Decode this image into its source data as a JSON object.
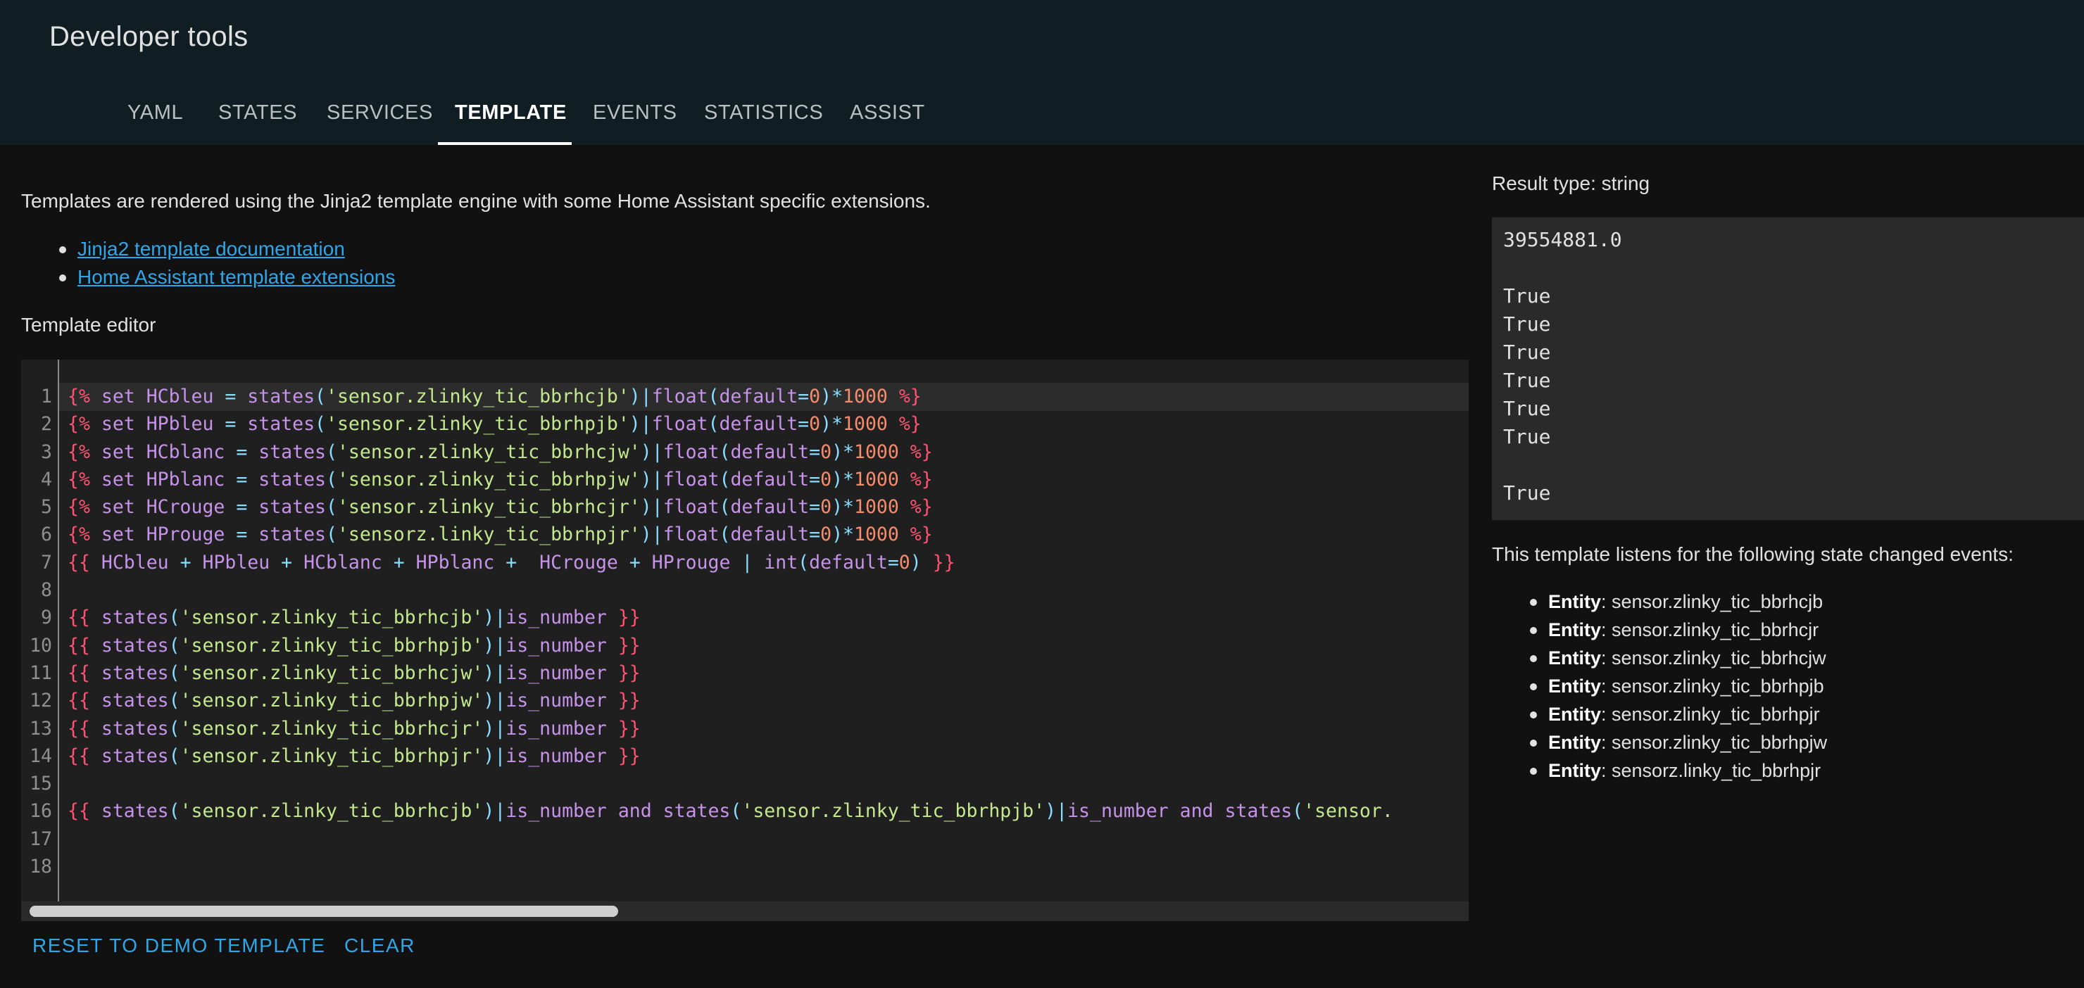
{
  "header": {
    "title": "Developer tools",
    "tabs": [
      "YAML",
      "STATES",
      "SERVICES",
      "TEMPLATE",
      "EVENTS",
      "STATISTICS",
      "ASSIST"
    ],
    "active_tab": "TEMPLATE"
  },
  "intro": "Templates are rendered using the Jinja2 template engine with some Home Assistant specific extensions.",
  "links": [
    "Jinja2 template documentation",
    "Home Assistant template extensions"
  ],
  "editor": {
    "label": "Template editor",
    "line_numbers": [
      "1",
      "2",
      "3",
      "4",
      "5",
      "6",
      "7",
      "8",
      "9",
      "10",
      "11",
      "12",
      "13",
      "14",
      "15",
      "16",
      "17",
      "18"
    ],
    "lines": [
      "{% set HCbleu = states('sensor.zlinky_tic_bbrhcjb')|float(default=0)*1000 %}",
      "{% set HPbleu = states('sensor.zlinky_tic_bbrhpjb')|float(default=0)*1000 %}",
      "{% set HCblanc = states('sensor.zlinky_tic_bbrhcjw')|float(default=0)*1000 %}",
      "{% set HPblanc = states('sensor.zlinky_tic_bbrhpjw')|float(default=0)*1000 %}",
      "{% set HCrouge = states('sensor.zlinky_tic_bbrhcjr')|float(default=0)*1000 %}",
      "{% set HProuge = states('sensorz.linky_tic_bbrhpjr')|float(default=0)*1000 %}",
      "{{ HCbleu + HPbleu + HCblanc + HPblanc +  HCrouge + HProuge | int(default=0) }}",
      "",
      "{{ states('sensor.zlinky_tic_bbrhcjb')|is_number }}",
      "{{ states('sensor.zlinky_tic_bbrhpjb')|is_number }}",
      "{{ states('sensor.zlinky_tic_bbrhcjw')|is_number }}",
      "{{ states('sensor.zlinky_tic_bbrhpjw')|is_number }}",
      "{{ states('sensor.zlinky_tic_bbrhcjr')|is_number }}",
      "{{ states('sensor.zlinky_tic_bbrhpjr')|is_number }}",
      "",
      "{{ states('sensor.zlinky_tic_bbrhcjb')|is_number and states('sensor.zlinky_tic_bbrhpjb')|is_number and states('sensor.",
      "",
      ""
    ]
  },
  "buttons": {
    "reset": "RESET TO DEMO TEMPLATE",
    "clear": "CLEAR"
  },
  "result": {
    "type_label": "Result type: string",
    "lines": [
      "39554881.0",
      "",
      "True",
      "True",
      "True",
      "True",
      "True",
      "True",
      "",
      "True"
    ]
  },
  "listens": {
    "label": "This template listens for the following state changed events:",
    "entity_label": "Entity",
    "entities": [
      "sensor.zlinky_tic_bbrhcjb",
      "sensor.zlinky_tic_bbrhcjr",
      "sensor.zlinky_tic_bbrhcjw",
      "sensor.zlinky_tic_bbrhpjb",
      "sensor.zlinky_tic_bbrhpjr",
      "sensor.zlinky_tic_bbrhpjw",
      "sensorz.linky_tic_bbrhpjr"
    ]
  }
}
